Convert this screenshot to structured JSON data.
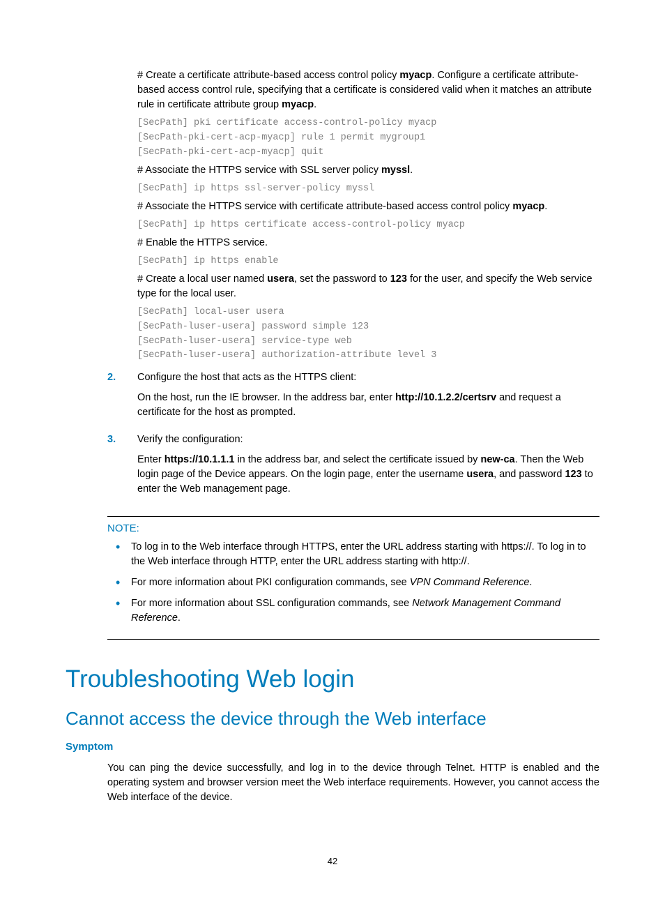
{
  "blocks": {
    "b1_pre": "# Create a certificate attribute-based access control policy ",
    "b1_bold1": "myacp",
    "b1_mid": ". Configure a certificate attribute-based access control rule, specifying that a certificate is considered valid when it matches an attribute rule in certificate attribute group ",
    "b1_bold2": "myacp",
    "b1_post": ".",
    "code1": "[SecPath] pki certificate access-control-policy myacp\n[SecPath-pki-cert-acp-myacp] rule 1 permit mygroup1\n[SecPath-pki-cert-acp-myacp] quit",
    "b2_pre": "# Associate the HTTPS service with SSL server policy ",
    "b2_bold": "myssl",
    "b2_post": ".",
    "code2": "[SecPath] ip https ssl-server-policy myssl",
    "b3_pre": "# Associate the HTTPS service with certificate attribute-based access control policy ",
    "b3_bold": "myacp",
    "b3_post": ".",
    "code3": "[SecPath] ip https certificate access-control-policy myacp",
    "b4": "# Enable the HTTPS service.",
    "code4": "[SecPath] ip https enable",
    "b5_pre": "# Create a local user named ",
    "b5_bold1": "usera",
    "b5_mid1": ", set the password to ",
    "b5_bold2": "123",
    "b5_mid2": " for the user, and specify the Web service type for the local user.",
    "code5": "[SecPath] local-user usera\n[SecPath-luser-usera] password simple 123\n[SecPath-luser-usera] service-type web\n[SecPath-luser-usera] authorization-attribute level 3",
    "step2_num": "2.",
    "step2_title": "Configure the host that acts as the HTTPS client:",
    "step2_p_pre": "On the host, run the IE browser. In the address bar, enter ",
    "step2_p_bold": "http://10.1.2.2/certsrv",
    "step2_p_post": " and request a certificate for the host as prompted.",
    "step3_num": "3.",
    "step3_title": "Verify the configuration:",
    "step3_p_pre": "Enter ",
    "step3_p_bold1": "https://10.1.1.1",
    "step3_p_mid1": " in the address bar, and select the certificate issued by ",
    "step3_p_bold2": "new-ca",
    "step3_p_mid2": ". Then the Web login page of the Device appears. On the login page, enter the username ",
    "step3_p_bold3": "usera",
    "step3_p_mid3": ", and password ",
    "step3_p_bold4": "123",
    "step3_p_post": " to enter the Web management page.",
    "note_label": "NOTE:",
    "note_b1": "To log in to the Web interface through HTTPS, enter the URL address starting with https://. To log in to the Web interface through HTTP, enter the URL address starting with http://.",
    "note_b2_pre": "For more information about PKI configuration commands, see ",
    "note_b2_it": "VPN Command Reference",
    "note_b2_post": ".",
    "note_b3_pre": "For more information about SSL configuration commands, see ",
    "note_b3_it": "Network Management Command Reference",
    "note_b3_post": ".",
    "h1": "Troubleshooting Web login",
    "h2": "Cannot access the device through the Web interface",
    "h3": "Symptom",
    "symptom_p": "You can ping the device successfully, and log in to the device through Telnet. HTTP is enabled and the operating system and browser version meet the Web interface requirements. However, you cannot access the Web interface of the device.",
    "page_num": "42"
  }
}
